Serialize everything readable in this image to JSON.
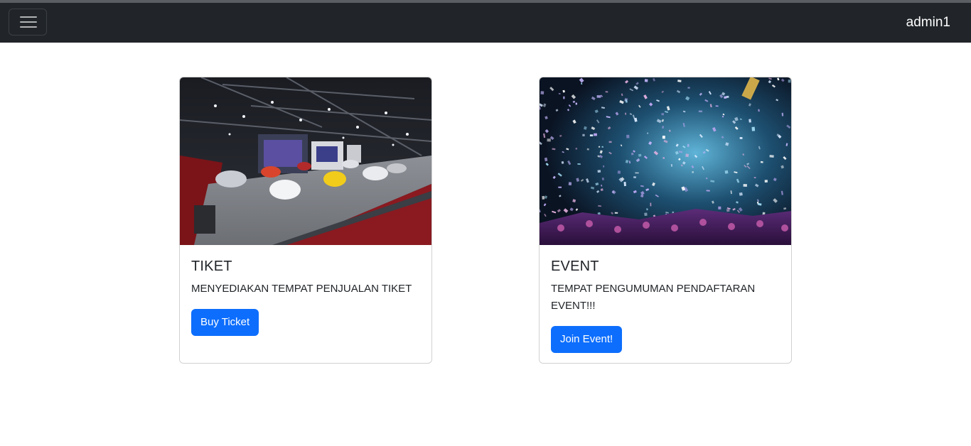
{
  "navbar": {
    "brand": "admin1",
    "toggle_icon": "hamburger-menu-icon"
  },
  "cards": [
    {
      "title": "TIKET",
      "text": "MENYEDIAKAN TEMPAT PENJUALAN TIKET",
      "button_label": "Buy Ticket"
    },
    {
      "title": "EVENT",
      "text": "TEMPAT PENGUMUMAN PENDAFTARAN EVENT!!!",
      "button_label": "Join Event!"
    }
  ],
  "colors": {
    "navbar_bg": "#212529",
    "button_primary": "#0d6efd"
  }
}
